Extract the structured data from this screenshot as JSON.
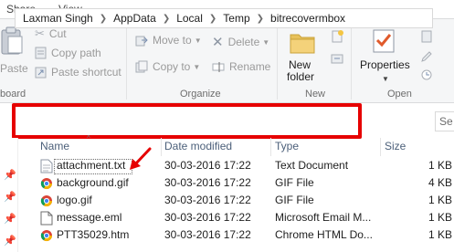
{
  "ribbon_tabs": {
    "share": "Share",
    "view": "View"
  },
  "clipboard": {
    "paste": "Paste",
    "cut": "Cut",
    "copy_path": "Copy path",
    "paste_shortcut": "Paste shortcut",
    "group": "board"
  },
  "organize": {
    "move_to": "Move to",
    "copy_to": "Copy to",
    "delete": "Delete",
    "rename": "Rename",
    "group": "Organize"
  },
  "new": {
    "new_folder_line1": "New",
    "new_folder_line2": "folder",
    "group": "New"
  },
  "open": {
    "properties": "Properties",
    "group": "Open"
  },
  "address": {
    "crumbs": [
      "Laxman Singh",
      "AppData",
      "Local",
      "Temp",
      "bitrecovermbox"
    ],
    "search_placeholder": "Se"
  },
  "columns": {
    "name": "Name",
    "date": "Date modified",
    "type": "Type",
    "size": "Size"
  },
  "files": [
    {
      "name": "attachment.txt",
      "date": "30-03-2016 17:22",
      "type": "Text Document",
      "size": "1 KB",
      "icon": "text-file-icon"
    },
    {
      "name": "background.gif",
      "date": "30-03-2016 17:22",
      "type": "GIF File",
      "size": "4 KB",
      "icon": "chrome-icon"
    },
    {
      "name": "logo.gif",
      "date": "30-03-2016 17:22",
      "type": "GIF File",
      "size": "1 KB",
      "icon": "chrome-icon"
    },
    {
      "name": "message.eml",
      "date": "30-03-2016 17:22",
      "type": "Microsoft Email M...",
      "size": "1 KB",
      "icon": "email-file-icon"
    },
    {
      "name": "PTT35029.htm",
      "date": "30-03-2016 17:22",
      "type": "Chrome HTML Do...",
      "size": "1 KB",
      "icon": "chrome-icon"
    }
  ],
  "colors": {
    "highlight_red": "#e60000",
    "header_text": "#4c607a"
  }
}
